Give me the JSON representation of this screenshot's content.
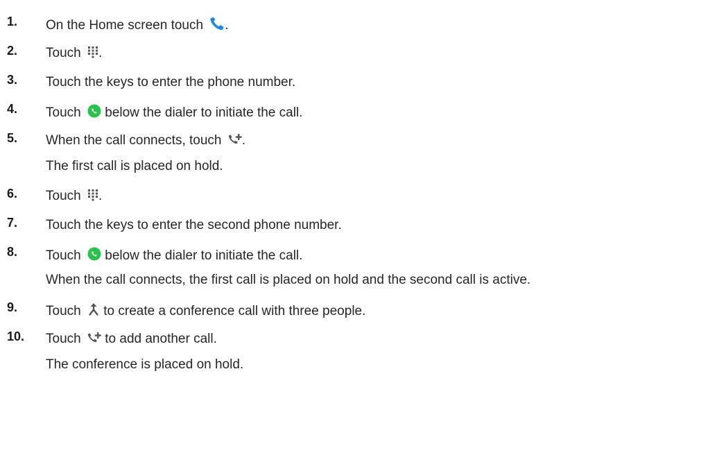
{
  "steps": [
    {
      "number": "1.",
      "before": "On the Home screen touch ",
      "icon": "phone-handset-icon",
      "after": "."
    },
    {
      "number": "2.",
      "before": "Touch ",
      "icon": "dialpad-icon",
      "after": "."
    },
    {
      "number": "3.",
      "before": "Touch the keys to enter the phone number.",
      "icon": "",
      "after": ""
    },
    {
      "number": "4.",
      "before": "Touch ",
      "icon": "green-call-button-icon",
      "after": " below the dialer to initiate the call."
    },
    {
      "number": "5.",
      "before": "When the call connects, touch ",
      "icon": "add-call-icon",
      "after": ".",
      "sub": "The first call is placed on hold."
    },
    {
      "number": "6.",
      "before": "Touch ",
      "icon": "dialpad-icon",
      "after": "."
    },
    {
      "number": "7.",
      "before": "Touch the keys to enter the second phone number.",
      "icon": "",
      "after": ""
    },
    {
      "number": "8.",
      "before": "Touch ",
      "icon": "green-call-button-icon",
      "after": " below the dialer to initiate the call.",
      "sub": "When the call connects, the first call is placed on hold and the second call is active."
    },
    {
      "number": "9.",
      "before": "Touch ",
      "icon": "merge-calls-icon",
      "after": " to create a conference call with three people."
    },
    {
      "number": "10.",
      "before": "Touch ",
      "icon": "add-call-icon",
      "after": " to add another call.",
      "sub": "The conference is placed on hold."
    }
  ],
  "colors": {
    "phone_icon": "#1e88e5",
    "call_button": "#2bc24a",
    "dark_icon": "#555555"
  }
}
